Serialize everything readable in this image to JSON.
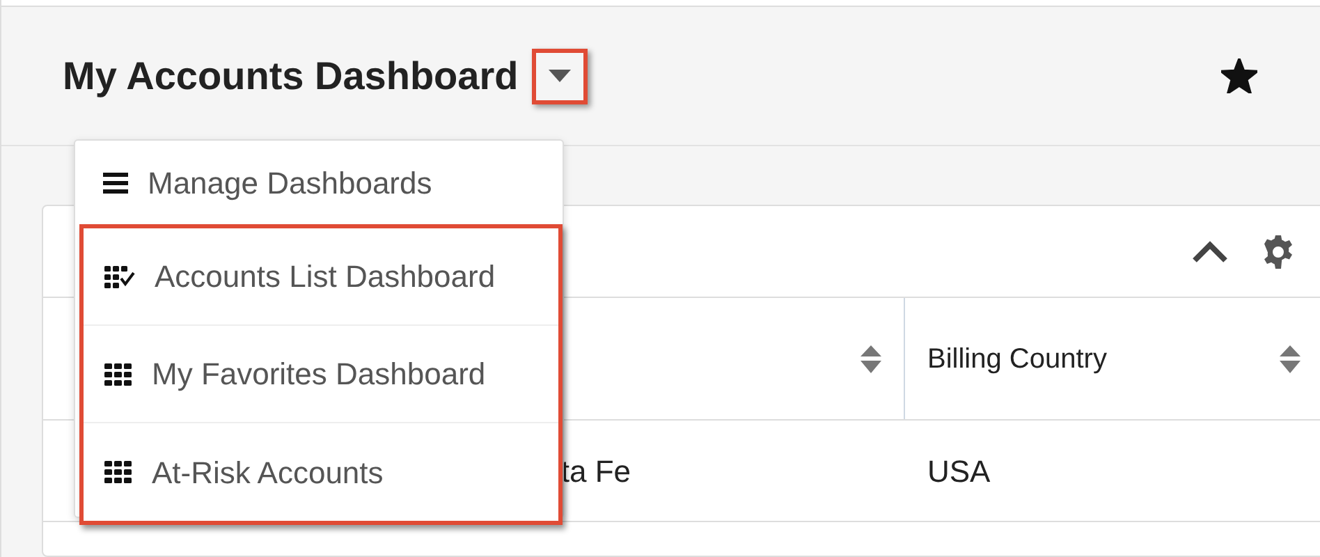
{
  "header": {
    "title": "My Accounts Dashboard",
    "favorite": true
  },
  "dashboard_menu": {
    "items": [
      {
        "kind": "manage",
        "label": "Manage Dashboards"
      },
      {
        "kind": "current",
        "label": "Accounts List Dashboard"
      },
      {
        "kind": "dashboard",
        "label": "My Favorites Dashboard"
      },
      {
        "kind": "dashboard",
        "label": "At-Risk Accounts"
      }
    ]
  },
  "dashlet": {
    "expanded": true,
    "table": {
      "columns": [
        "",
        "Billing Country"
      ],
      "rows": [
        [
          "ta Fe",
          "USA"
        ]
      ]
    }
  }
}
